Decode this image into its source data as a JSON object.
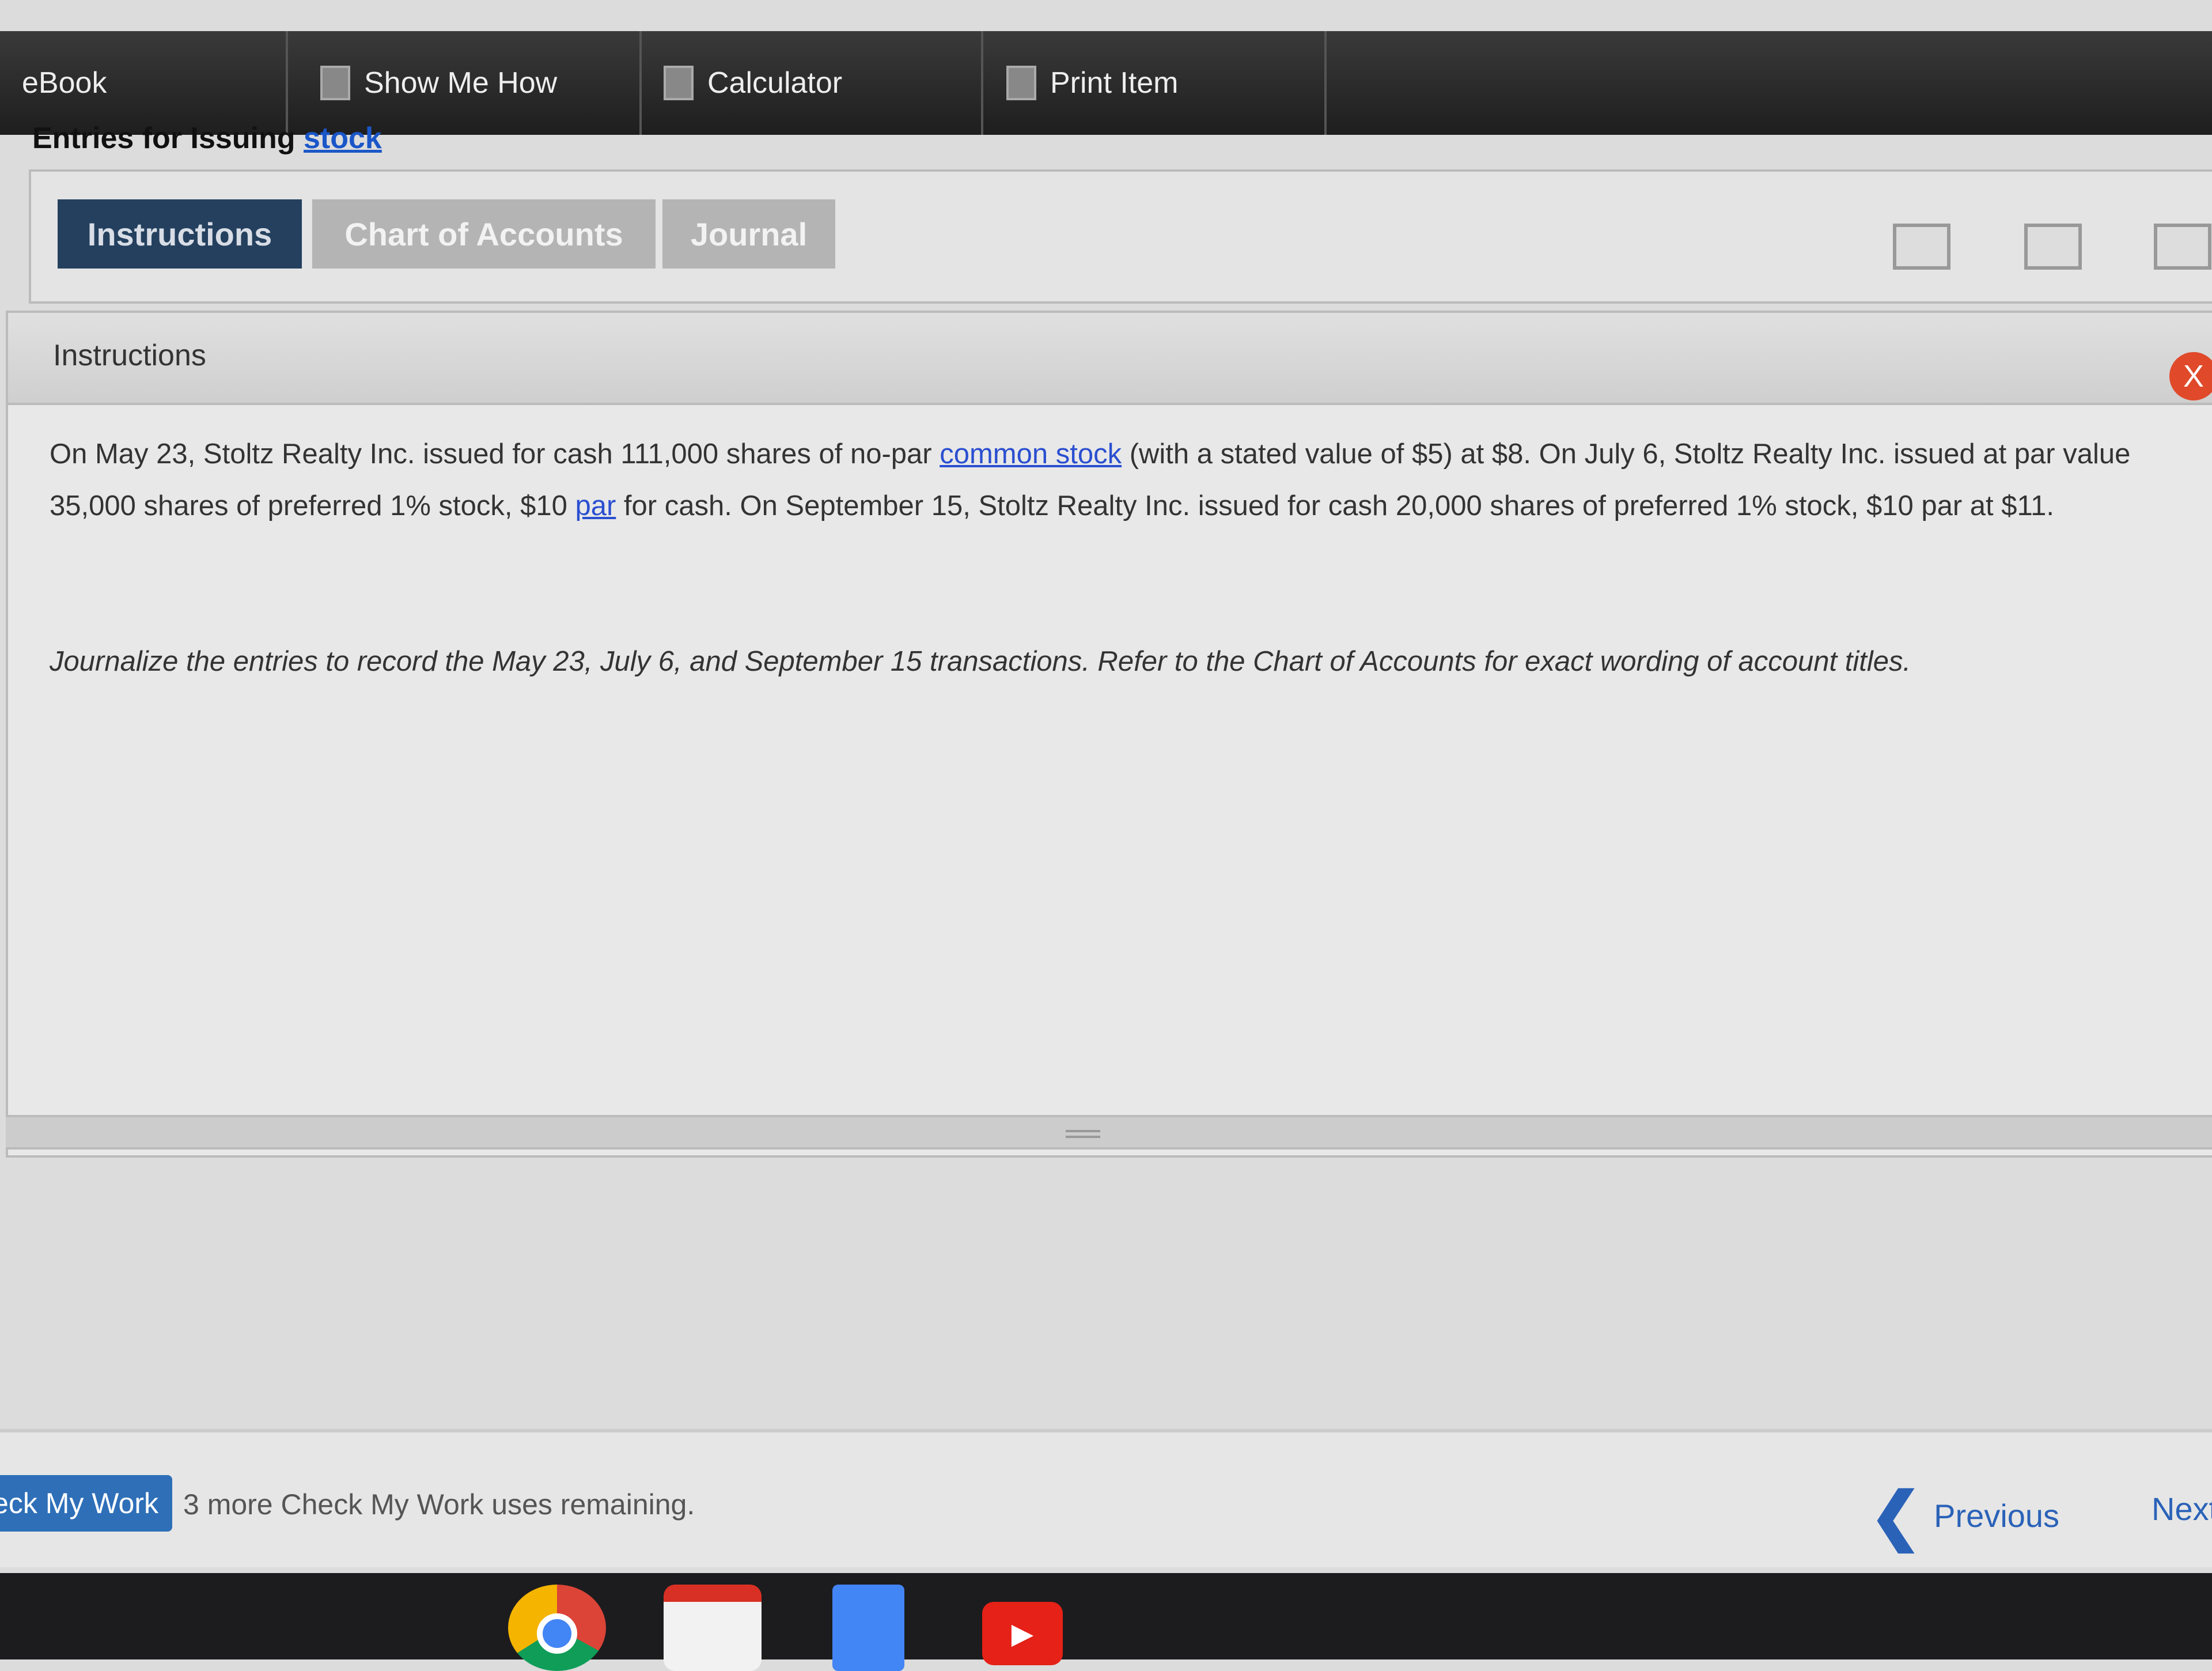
{
  "toolbar": {
    "ebook": "eBook",
    "show_me_how": "Show Me How",
    "calculator": "Calculator",
    "print_item": "Print Item"
  },
  "title": {
    "prefix": "Entries for Issuing ",
    "link": "stock"
  },
  "tabs": [
    {
      "label": "Instructions",
      "active": true
    },
    {
      "label": "Chart of Accounts"
    },
    {
      "label": "Journal"
    }
  ],
  "view_icons": [
    "single-panel-icon",
    "split-panel-icon",
    "list-panel-icon"
  ],
  "instructions": {
    "header": "Instructions",
    "close": "X",
    "p1_a": "On May 23, Stoltz Realty Inc. issued for cash 111,000 shares of no-par ",
    "p1_link1": "common stock",
    "p1_b": " (with a stated value of $5) at $8. On July 6, Stoltz Realty Inc. issued at par value 35,000 shares of preferred 1% stock, $10 ",
    "p1_link2": "par",
    "p1_c": " for cash. On September 15, Stoltz Realty Inc. issued for cash 20,000 shares of preferred 1% stock, $10 par at $11.",
    "p2": "Journalize the entries to record the May 23, July 6, and September 15 transactions. Refer to the Chart of Accounts for exact wording of account titles."
  },
  "footer": {
    "check_my_work": "Check My Work",
    "remaining": "3 more Check My Work uses remaining.",
    "previous": "Previous",
    "next": "Next"
  },
  "taskbar": {
    "apps": [
      "chrome",
      "gmail",
      "docs",
      "youtube"
    ]
  },
  "colors": {
    "active_tab": "#24405e",
    "link": "#2a4fd0",
    "close": "#e04a2a",
    "check_button": "#2e6fb8"
  }
}
